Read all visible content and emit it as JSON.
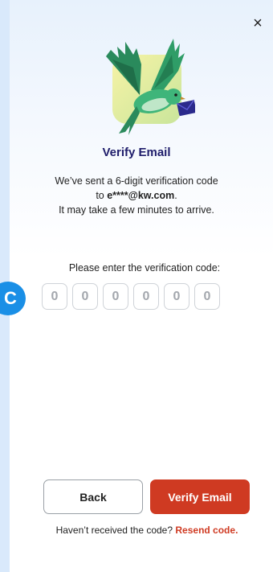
{
  "dialog": {
    "close_label": "×",
    "title": "Verify Email",
    "description": {
      "line1": "We’ve sent a 6-digit verification code",
      "line2_prefix": "to ",
      "email": "e****@kw.com",
      "line2_suffix": ".",
      "line3": "It may take a few minutes to arrive."
    },
    "prompt": "Please enter the verification code:",
    "code_digits": [
      "0",
      "0",
      "0",
      "0",
      "0",
      "0"
    ],
    "badge_letter": "C",
    "back_label": "Back",
    "verify_label": "Verify Email",
    "resend_prompt": "Haven’t received the code?",
    "resend_link": "Resend code.",
    "colors": {
      "accent": "#cf3a22",
      "title": "#1f1d6b",
      "badge": "#1a8fe6"
    },
    "icons": {
      "close": "close-icon",
      "illustration": "bird-with-envelope-illustration"
    }
  }
}
